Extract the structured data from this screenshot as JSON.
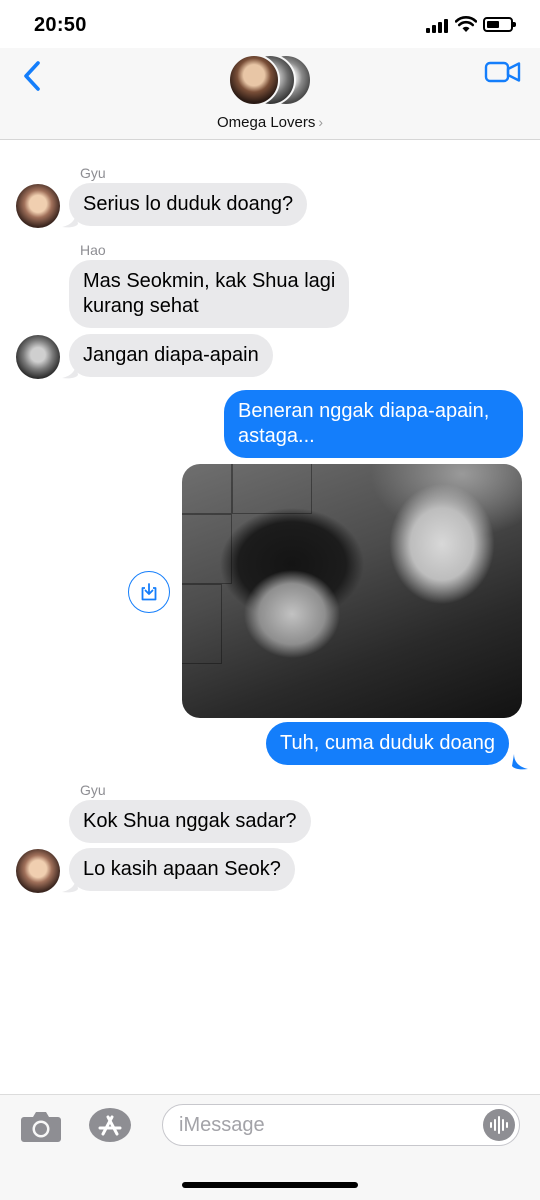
{
  "status_bar": {
    "time": "20:50"
  },
  "header": {
    "group_name": "Omega Lovers",
    "accent_color": "#147efb",
    "icons": {
      "back": "chevron-left-icon",
      "video": "video-camera-icon",
      "group_chevron": "chevron-right-icon"
    }
  },
  "messages": [
    {
      "type": "incoming",
      "sender": "Gyu",
      "text": "Serius lo duduk doang?"
    },
    {
      "type": "incoming",
      "sender": "Hao",
      "text_lines": [
        "Mas Seokmin, kak Shua lagi",
        "kurang sehat"
      ]
    },
    {
      "type": "incoming",
      "sender": "Hao",
      "text": "Jangan diapa-apain"
    },
    {
      "type": "outgoing",
      "text_lines": [
        "Beneran nggak diapa-apain,",
        "astaga..."
      ]
    },
    {
      "type": "outgoing-photo",
      "description_icon": "photo"
    },
    {
      "type": "outgoing",
      "text": "Tuh, cuma duduk doang"
    },
    {
      "type": "incoming",
      "sender": "Gyu",
      "text": "Kok Shua nggak sadar?"
    },
    {
      "type": "incoming",
      "sender": "Gyu",
      "text": "Lo kasih apaan Seok?"
    }
  ],
  "input_bar": {
    "placeholder": "iMessage",
    "icons": {
      "camera": "camera-icon",
      "apps": "app-store-icon",
      "audio": "audio-waveform-icon",
      "download": "download-icon"
    }
  },
  "colors": {
    "incoming_bubble": "#e9e9eb",
    "outgoing_bubble": "#147efb"
  }
}
